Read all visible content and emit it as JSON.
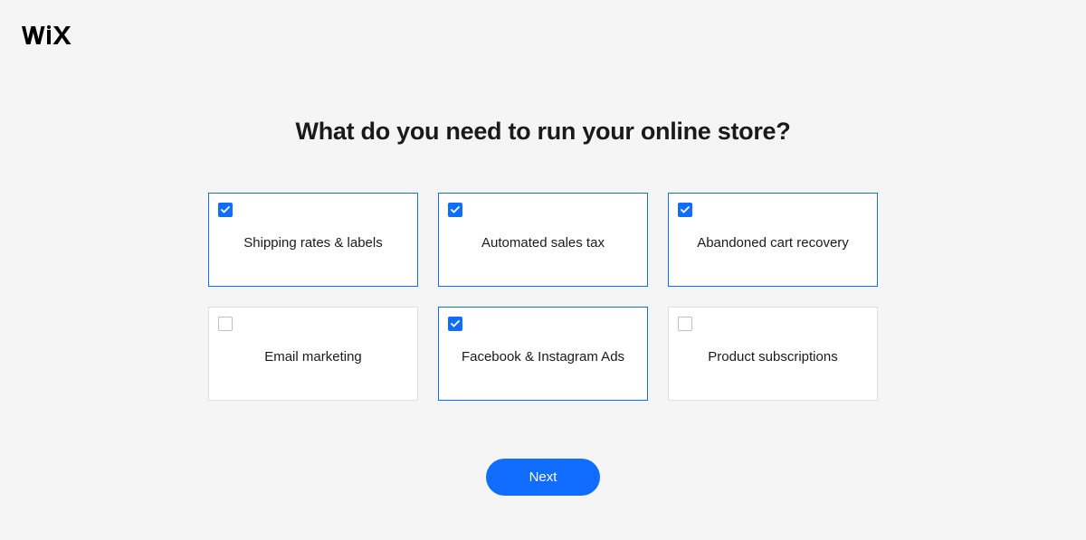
{
  "logo": "WIX",
  "heading": "What do you need to run your online store?",
  "options": [
    {
      "label": "Shipping rates & labels",
      "checked": true
    },
    {
      "label": "Automated sales tax",
      "checked": true
    },
    {
      "label": "Abandoned cart recovery",
      "checked": true
    },
    {
      "label": "Email marketing",
      "checked": false
    },
    {
      "label": "Facebook & Instagram Ads",
      "checked": true
    },
    {
      "label": "Product subscriptions",
      "checked": false
    }
  ],
  "next_button": "Next",
  "colors": {
    "accent": "#116dff",
    "background": "#f5f5f5",
    "card_bg": "#ffffff",
    "text": "#1a1a1a"
  }
}
